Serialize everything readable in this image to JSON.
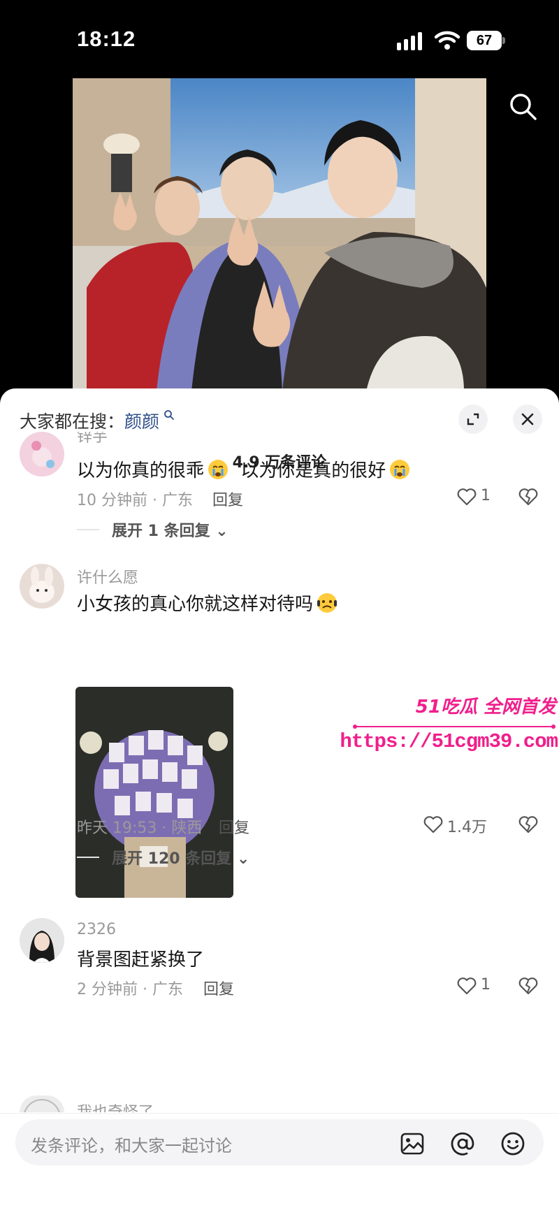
{
  "status_bar": {
    "time": "18:12",
    "battery": "67"
  },
  "trending": {
    "prefix": "大家都在搜：",
    "term": "颜颜"
  },
  "comments_header": {
    "count": "4.9 万条评论"
  },
  "comments": [
    {
      "username": "锌芋",
      "text": "以为你真的很乖",
      "text2": "以为你是真的很好",
      "meta": "10 分钟前 · 广东",
      "reply": "回复",
      "likes": "1",
      "expand": "展开 1 条回复"
    },
    {
      "username": "许什么愿",
      "text": "小女孩的真心你就这样对待吗",
      "meta": "昨天 19:53 · 陕西",
      "reply": "回复",
      "likes": "1.4万",
      "expand": "展开 120 条回复"
    },
    {
      "username": "2326",
      "text": "背景图赶紧换了",
      "meta": "2 分钟前 · 广东",
      "reply": "回复",
      "likes": "1"
    },
    {
      "username": "我也奇怪了"
    }
  ],
  "watermark": {
    "brand": "51吃瓜 全网首发",
    "url": "https://51cgm39.com"
  },
  "input": {
    "placeholder": "发条评论，和大家一起讨论"
  },
  "icons": {
    "search": "search-icon",
    "expand": "expand-icon",
    "close": "close-icon",
    "like": "heart-icon",
    "dislike": "broken-heart-icon",
    "image": "image-icon",
    "mention": "at-icon",
    "emoji": "smiley-icon"
  },
  "colors": {
    "accent_link": "#2f4f8a",
    "watermark": "#f01f8c"
  }
}
